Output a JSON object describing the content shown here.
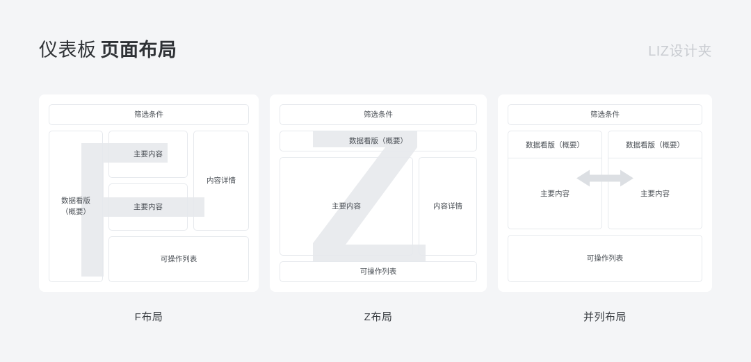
{
  "header": {
    "title_light": "仪表板",
    "title_bold": "页面布局",
    "watermark": "LIZ设计夹"
  },
  "colors": {
    "page_bg": "#f4f5f7",
    "panel_bg": "#ffffff",
    "box_border": "#e6e9ed",
    "glyph_gray": "#e9ebee",
    "text": "#4a4f55",
    "title": "#2f3236",
    "watermark": "#c9ccd1",
    "arrow": "#dcdfe3"
  },
  "panels": [
    {
      "id": "f-layout",
      "caption": "F布局",
      "watermark_glyph": "F",
      "blocks": {
        "filter": "筛选条件",
        "board": "数据看版\n（概要）",
        "main_1": "主要内容",
        "main_2": "主要内容",
        "detail": "内容详情",
        "list": "可操作列表"
      }
    },
    {
      "id": "z-layout",
      "caption": "Z布局",
      "watermark_glyph": "Z",
      "blocks": {
        "filter": "筛选条件",
        "board": "数据看版（概要）",
        "main": "主要内容",
        "detail": "内容详情",
        "list": "可操作列表"
      }
    },
    {
      "id": "parallel-layout",
      "caption": "并列布局",
      "watermark_glyph": "double-arrow",
      "blocks": {
        "filter": "筛选条件",
        "board_left": "数据看版（概要）",
        "board_right": "数据看版（概要）",
        "main_left": "主要内容",
        "main_right": "主要内容",
        "list": "可操作列表"
      }
    }
  ]
}
